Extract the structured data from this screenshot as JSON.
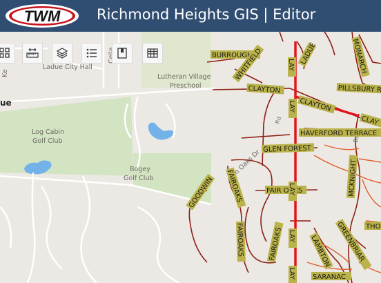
{
  "app": {
    "logo_text": "TWM",
    "title": "Richmond Heights GIS | Editor"
  },
  "toolbar": {
    "buttons": [
      {
        "name": "select-tool-button",
        "icon": "grid-select-icon"
      },
      {
        "name": "measure-tool-button",
        "icon": "measure-icon"
      },
      {
        "name": "layers-button",
        "icon": "layers-icon"
      },
      {
        "name": "legend-button",
        "icon": "list-icon"
      },
      {
        "name": "bookmarks-button",
        "icon": "bookmark-icon"
      },
      {
        "name": "attribute-table-button",
        "icon": "table-icon"
      }
    ]
  },
  "map": {
    "base_labels": {
      "city_hall": "Ladue City Hall",
      "preschool_line1": "Lutheran Village",
      "preschool_line2": "Preschool",
      "log_cabin_line1": "Log Cabin",
      "log_cabin_line2": "Golf Club",
      "bogey_line1": "Bogey",
      "bogey_line2": "Golf Club",
      "avenue_fragment": "ue",
      "cella_fragment": "Cella",
      "ke_fragment": "Ke",
      "oaks_dr": "ran Oaks Dr",
      "rd_fragment": "Rd"
    },
    "street_labels": {
      "burroughs": "BURROUGHS",
      "whitfield": "WHITFIELD",
      "ladue": "LADUE",
      "monarch": "MONARCH",
      "lay_top": "LAY",
      "clayton_w": "CLAYTON",
      "clayton_e": "CLAYTON",
      "clay_edge": "CLAY",
      "pillsbury": "PILLSBURY RD",
      "haverford": "HAVERFORD TERRACE",
      "glen_forest": "GLEN FOREST",
      "lay_mid": "LAY",
      "fairoaks_v": "FAIROAKS",
      "fair_oaks": "FAIR OAKS",
      "goodwin": "GOODWIN",
      "fairoaks_lower": "FAIROAKS",
      "fairoaks_right": "FAIROAKS",
      "lay_low": "LAY",
      "lay_bottom": "LAY",
      "lambton": "LAMBTON",
      "mcknight": "MCKNIGHT",
      "thor": "THO",
      "greenbriar": "GREENBRIAR",
      "saranac": "SARANAC"
    },
    "colors": {
      "header": "#304d72",
      "background": "#ece9e4",
      "park": "#d3e4c2",
      "water": "#73b2e8",
      "red_road": "#e2141a",
      "brown_road": "#8c1e12",
      "orange_road": "#e05e2a",
      "label_bg": "#bab24a"
    }
  }
}
